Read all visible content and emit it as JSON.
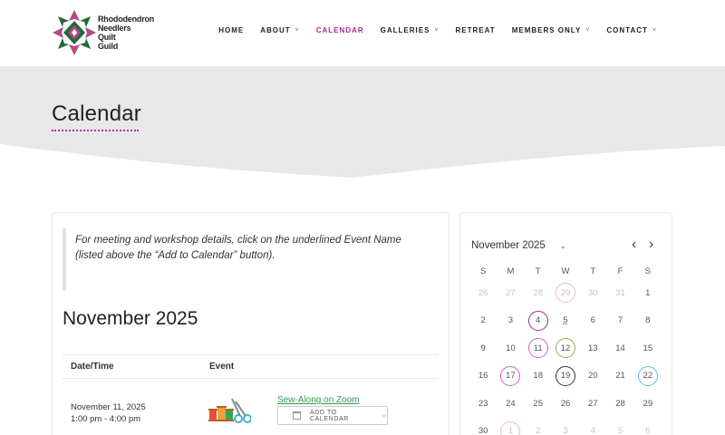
{
  "brand": {
    "lines": [
      "Rhododendron",
      "Needlers",
      "Quilt",
      "Guild"
    ]
  },
  "nav": [
    {
      "label": "HOME",
      "dropdown": false,
      "active": false
    },
    {
      "label": "ABOUT",
      "dropdown": true,
      "active": false
    },
    {
      "label": "CALENDAR",
      "dropdown": false,
      "active": true
    },
    {
      "label": "GALLERIES",
      "dropdown": true,
      "active": false
    },
    {
      "label": "RETREAT",
      "dropdown": false,
      "active": false
    },
    {
      "label": "MEMBERS ONLY",
      "dropdown": true,
      "active": false
    },
    {
      "label": "CONTACT",
      "dropdown": true,
      "active": false
    }
  ],
  "page": {
    "title": "Calendar"
  },
  "main": {
    "note": "For meeting and workshop details, click on the underlined Event Name (listed above the “Add to Calendar” button).",
    "month_heading": "November 2025",
    "table": {
      "headers": [
        "Date/Time",
        "Event"
      ],
      "rows": [
        {
          "date": "November 11, 2025",
          "time": "1:00 pm - 4:00 pm",
          "event": "Sew-Along on Zoom",
          "add_to_calendar": "ADD TO CALENDAR",
          "icon": "sewing-supplies-icon"
        }
      ]
    }
  },
  "sidebar": {
    "month_label": "November 2025",
    "weekdays": [
      "S",
      "M",
      "T",
      "W",
      "T",
      "F",
      "S"
    ],
    "weeks": [
      [
        {
          "d": "26",
          "m": true
        },
        {
          "d": "27",
          "m": true
        },
        {
          "d": "28",
          "m": true
        },
        {
          "d": "29",
          "m": true,
          "ring": "#e9b5d6"
        },
        {
          "d": "30",
          "m": true
        },
        {
          "d": "31",
          "m": true
        },
        {
          "d": "1"
        }
      ],
      [
        {
          "d": "2"
        },
        {
          "d": "3"
        },
        {
          "d": "4",
          "ring": "#9b2f8e"
        },
        {
          "d": "5",
          "dot": true
        },
        {
          "d": "6"
        },
        {
          "d": "7"
        },
        {
          "d": "8"
        }
      ],
      [
        {
          "d": "9"
        },
        {
          "d": "10"
        },
        {
          "d": "11",
          "ring": "#d85cc0"
        },
        {
          "d": "12",
          "ring": "#a6a454"
        },
        {
          "d": "13"
        },
        {
          "d": "14"
        },
        {
          "d": "15"
        }
      ],
      [
        {
          "d": "16"
        },
        {
          "d": "17",
          "ring": "#d85cc0"
        },
        {
          "d": "18"
        },
        {
          "d": "19",
          "ring": "#333333"
        },
        {
          "d": "20"
        },
        {
          "d": "21"
        },
        {
          "d": "22",
          "ring": "#5cc8d6"
        }
      ],
      [
        {
          "d": "23"
        },
        {
          "d": "24"
        },
        {
          "d": "25"
        },
        {
          "d": "26"
        },
        {
          "d": "27"
        },
        {
          "d": "28"
        },
        {
          "d": "29"
        }
      ],
      [
        {
          "d": "30"
        },
        {
          "d": "1",
          "m": true,
          "ring": "#e9b5d6"
        },
        {
          "d": "2",
          "m": true
        },
        {
          "d": "3",
          "m": true
        },
        {
          "d": "4",
          "m": true
        },
        {
          "d": "5",
          "m": true
        },
        {
          "d": "6",
          "m": true
        }
      ]
    ]
  },
  "colors": {
    "accent": "#b0288f",
    "link": "#2e9a4a"
  }
}
